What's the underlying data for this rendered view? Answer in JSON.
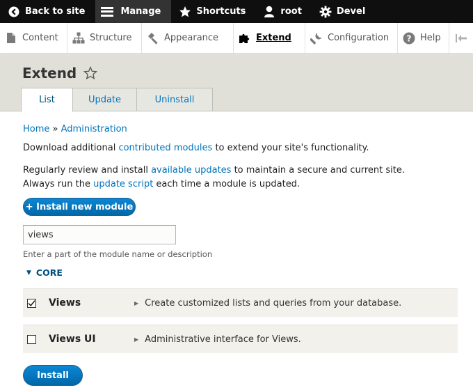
{
  "toolbar": {
    "back_label": "Back to site",
    "manage_label": "Manage",
    "shortcuts_label": "Shortcuts",
    "user_label": "root",
    "devel_label": "Devel"
  },
  "tray": {
    "items": [
      {
        "label": "Content",
        "icon": "document-icon"
      },
      {
        "label": "Structure",
        "icon": "structure-icon"
      },
      {
        "label": "Appearance",
        "icon": "paintbrush-icon"
      },
      {
        "label": "Extend",
        "icon": "puzzle-icon",
        "active": true
      },
      {
        "label": "Configuration",
        "icon": "wrench-icon"
      },
      {
        "label": "Help",
        "icon": "help-icon"
      }
    ]
  },
  "page": {
    "title": "Extend"
  },
  "tabs": [
    {
      "label": "List",
      "active": true
    },
    {
      "label": "Update"
    },
    {
      "label": "Uninstall"
    }
  ],
  "breadcrumb": {
    "home": "Home",
    "sep": "»",
    "admin": "Administration"
  },
  "intro": {
    "p1_before": "Download additional ",
    "p1_link": "contributed modules",
    "p1_after": " to extend your site's functionality.",
    "p2_before": "Regularly review and install ",
    "p2_link1": "available updates",
    "p2_mid": " to maintain a secure and current site.",
    "p2_line2_before": "Always run the ",
    "p2_link2": "update script",
    "p2_after": " each time a module is updated."
  },
  "install_new_label": "+ Install new module",
  "filter": {
    "value": "views",
    "description": "Enter a part of the module name or description"
  },
  "package": {
    "label": "CORE"
  },
  "modules": [
    {
      "name": "Views",
      "description": "Create customized lists and queries from your database.",
      "checked": true
    },
    {
      "name": "Views UI",
      "description": "Administrative interface for Views.",
      "checked": false
    }
  ],
  "install_label": "Install",
  "colors": {
    "toolbar": "#0f0f0f",
    "link": "#0074bd",
    "button": "#0071b8",
    "header_bg": "#e0e0d8",
    "row_bg": "#f2f1eb"
  }
}
